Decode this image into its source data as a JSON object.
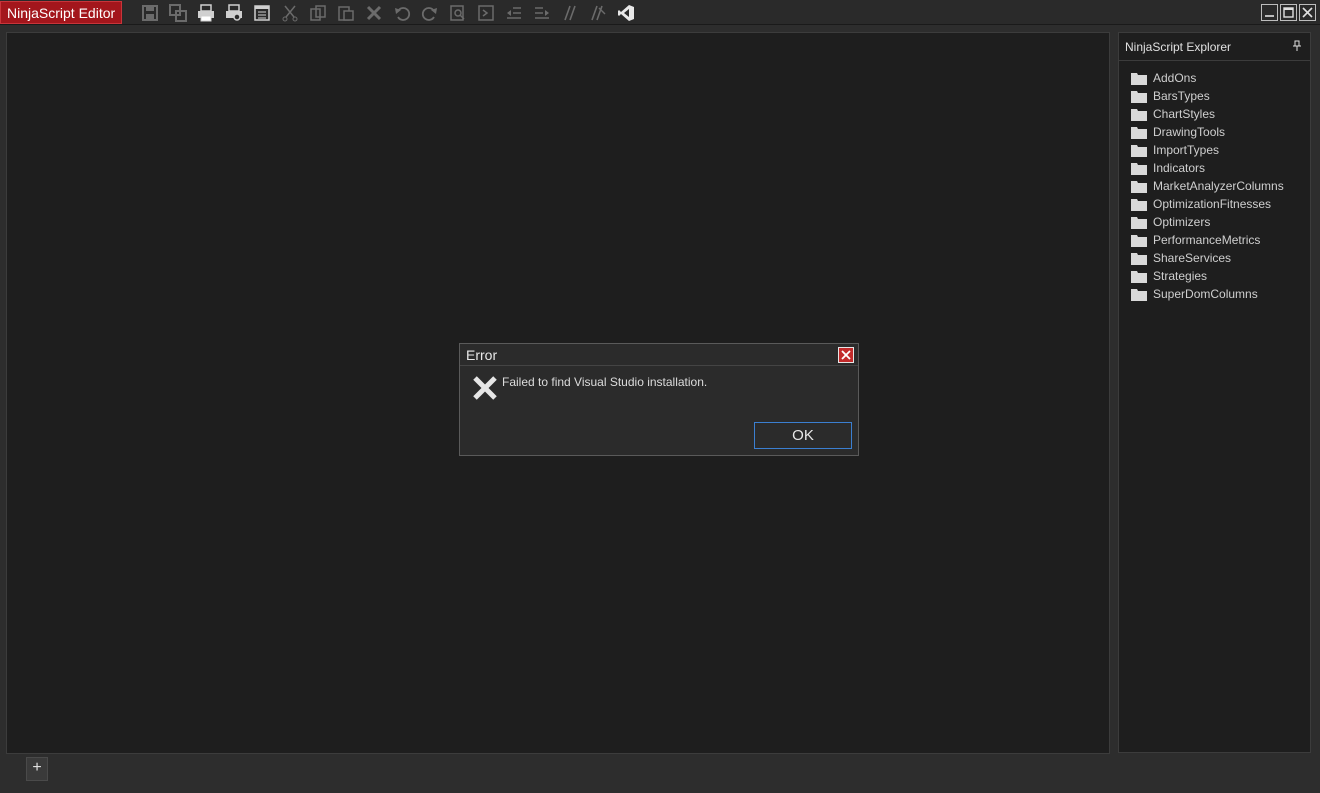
{
  "app": {
    "title": "NinjaScript Editor"
  },
  "toolbar": {
    "buttons": [
      {
        "icon": "save-icon"
      },
      {
        "icon": "save-all-icon"
      },
      {
        "icon": "print-icon"
      },
      {
        "icon": "print-preview-icon"
      },
      {
        "icon": "properties-icon"
      },
      {
        "icon": "cut-icon"
      },
      {
        "icon": "copy-icon"
      },
      {
        "icon": "paste-icon"
      },
      {
        "icon": "delete-icon"
      },
      {
        "icon": "undo-icon"
      },
      {
        "icon": "redo-icon"
      },
      {
        "icon": "find-icon"
      },
      {
        "icon": "compile-icon"
      },
      {
        "icon": "outdent-icon"
      },
      {
        "icon": "indent-icon"
      },
      {
        "icon": "comment-icon"
      },
      {
        "icon": "uncomment-icon"
      },
      {
        "icon": "visual-studio-icon"
      }
    ]
  },
  "explorer": {
    "title": "NinjaScript Explorer",
    "items": [
      "AddOns",
      "BarsTypes",
      "ChartStyles",
      "DrawingTools",
      "ImportTypes",
      "Indicators",
      "MarketAnalyzerColumns",
      "OptimizationFitnesses",
      "Optimizers",
      "PerformanceMetrics",
      "ShareServices",
      "Strategies",
      "SuperDomColumns"
    ]
  },
  "dialog": {
    "title": "Error",
    "message": "Failed to find Visual Studio installation.",
    "ok_label": "OK"
  },
  "tabs": {
    "add_label": "+"
  },
  "colors": {
    "accent": "#a3161c",
    "focus": "#3b7fd1",
    "background": "#1e1e1e"
  }
}
